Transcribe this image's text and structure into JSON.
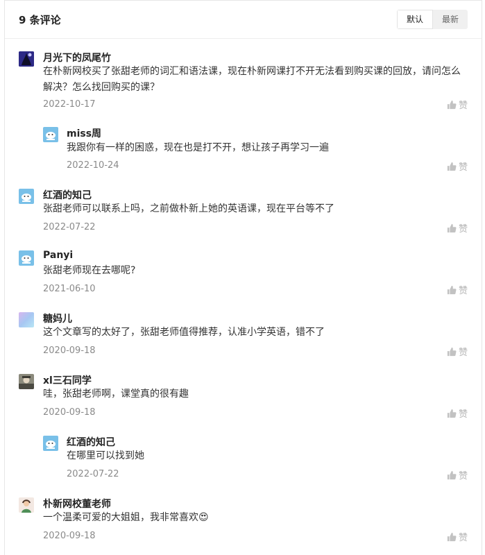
{
  "header": {
    "title": "9 条评论",
    "sort_options": [
      "默认",
      "最新"
    ]
  },
  "like_label": "赞",
  "comments": [
    {
      "name": "月光下的凤尾竹",
      "text": "在朴新网校买了张甜老师的词汇和语法课，现在朴新网课打不开无法看到购买课的回放，请问怎么解决？怎么找回购买的课？",
      "date": "2022-10-17",
      "avatar": "moon-avatar"
    },
    {
      "name": "miss周",
      "text": "我跟你有一样的困惑，现在也是打不开，想让孩子再学习一遍",
      "date": "2022-10-24",
      "avatar": "default-avatar"
    },
    {
      "name": "红酒的知己",
      "text": "张甜老师可以联系上吗，之前做朴新上她的英语课，现在平台等不了",
      "date": "2022-07-22",
      "avatar": "default-avatar"
    },
    {
      "name": "Panyi",
      "text": "张甜老师现在去哪呢?",
      "date": "2021-06-10",
      "avatar": "default-avatar"
    },
    {
      "name": "糖妈儿",
      "text": "这个文章写的太好了，张甜老师值得推荐，认准小学英语，错不了",
      "date": "2020-09-18",
      "avatar": "gradient-avatar"
    },
    {
      "name": "xl三石同学",
      "text": "哇，张甜老师啊，课堂真的很有趣",
      "date": "2020-09-18",
      "avatar": "photo-avatar"
    },
    {
      "name": "红酒的知己",
      "text": "在哪里可以找到她",
      "date": "2022-07-22",
      "avatar": "default-avatar"
    },
    {
      "name": "朴新网校董老师",
      "text": "一个温柔可爱的大姐姐，我非常喜欢😍",
      "date": "2020-09-18",
      "avatar": "teacher-avatar"
    }
  ]
}
